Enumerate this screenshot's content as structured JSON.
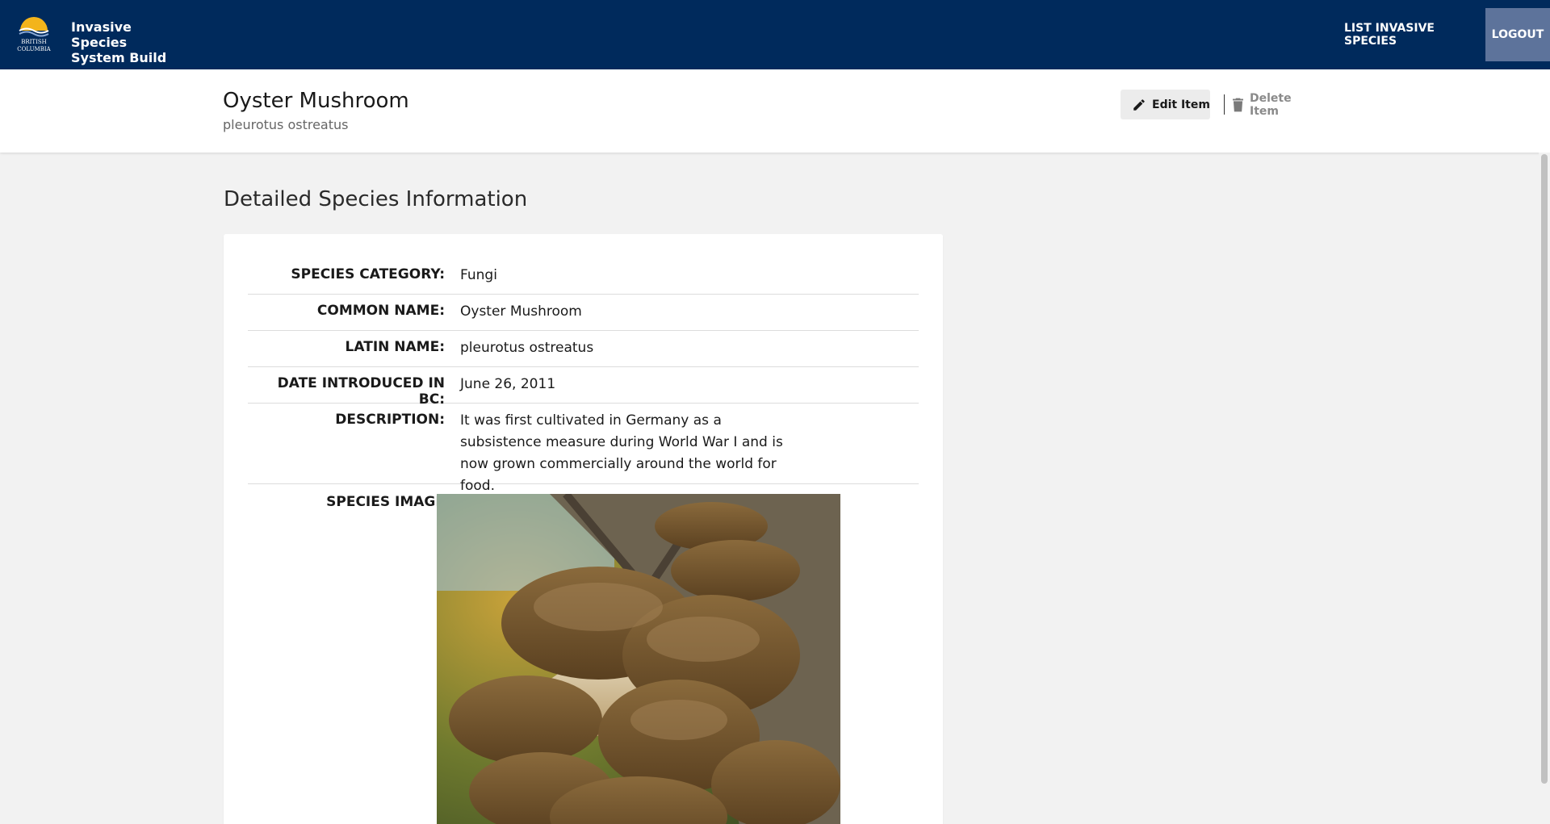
{
  "header": {
    "logo_text_top": "BRITISH",
    "logo_text_bottom": "COLUMBIA",
    "brand_line1": "Invasive Species",
    "brand_line2": "System Build",
    "nav_list": "LIST INVASIVE SPECIES",
    "nav_logout": "LOGOUT"
  },
  "titlebar": {
    "title": "Oyster Mushroom",
    "subtitle": "pleurotus ostreatus",
    "edit_label": "Edit Item",
    "delete_label": "Delete Item"
  },
  "main": {
    "section_title": "Detailed Species Information",
    "fields": [
      {
        "label": "SPECIES CATEGORY:",
        "value": "Fungi"
      },
      {
        "label": "COMMON NAME:",
        "value": "Oyster Mushroom"
      },
      {
        "label": "LATIN NAME:",
        "value": "pleurotus ostreatus"
      },
      {
        "label": "DATE INTRODUCED IN BC:",
        "value": "June 26, 2011"
      },
      {
        "label": "DESCRIPTION:",
        "value": "It was first cultivated in Germany as a subsistence measure during World War I and is now grown commercially around the world for food."
      },
      {
        "label": "SPECIES IMAGE",
        "value": ""
      }
    ]
  },
  "colors": {
    "header_bg": "#002a5c",
    "logout_bg": "#5d739b",
    "edit_bg": "#ececec",
    "page_bg": "#f2f2f2",
    "logo_gold": "#f3b41b"
  }
}
